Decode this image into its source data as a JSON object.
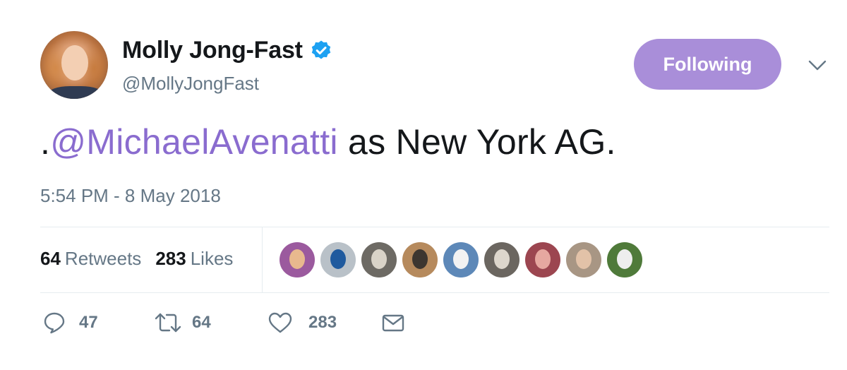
{
  "user": {
    "display_name": "Molly Jong-Fast",
    "handle": "@MollyJongFast",
    "verified": true
  },
  "follow_button": {
    "label": "Following"
  },
  "tweet": {
    "prefix": ".",
    "mention": "@MichaelAvenatti",
    "text": " as New York AG.",
    "timestamp": "5:54 PM - 8 May 2018"
  },
  "stats": {
    "retweets": {
      "count": "64",
      "label": "Retweets"
    },
    "likes": {
      "count": "283",
      "label": "Likes"
    }
  },
  "actions": {
    "reply_count": "47",
    "retweet_count": "64",
    "like_count": "283"
  },
  "colors": {
    "accent": "#8a6ccf",
    "follow_button_bg": "#a98ed9",
    "verified_badge": "#1da1f2",
    "muted_text": "#657786",
    "divider": "#e6ecf0"
  },
  "liker_avatars": [
    {
      "name": "liker-avatar-1",
      "bg": "#9b5a9e",
      "fg": "#e8b98e"
    },
    {
      "name": "liker-avatar-2",
      "bg": "#b9c1c8",
      "fg": "#1f5a9e"
    },
    {
      "name": "liker-avatar-3",
      "bg": "#6d6a64",
      "fg": "#d9d3c8"
    },
    {
      "name": "liker-avatar-4",
      "bg": "#b68a5d",
      "fg": "#3d3630"
    },
    {
      "name": "liker-avatar-5",
      "bg": "#5d88b8",
      "fg": "#f2f2f2"
    },
    {
      "name": "liker-avatar-6",
      "bg": "#6b6660",
      "fg": "#ddd6cc"
    },
    {
      "name": "liker-avatar-7",
      "bg": "#9c4650",
      "fg": "#e6a8a0"
    },
    {
      "name": "liker-avatar-8",
      "bg": "#a89684",
      "fg": "#e2c2a8"
    },
    {
      "name": "liker-avatar-9",
      "bg": "#4f7a3a",
      "fg": "#eeeeee"
    }
  ]
}
